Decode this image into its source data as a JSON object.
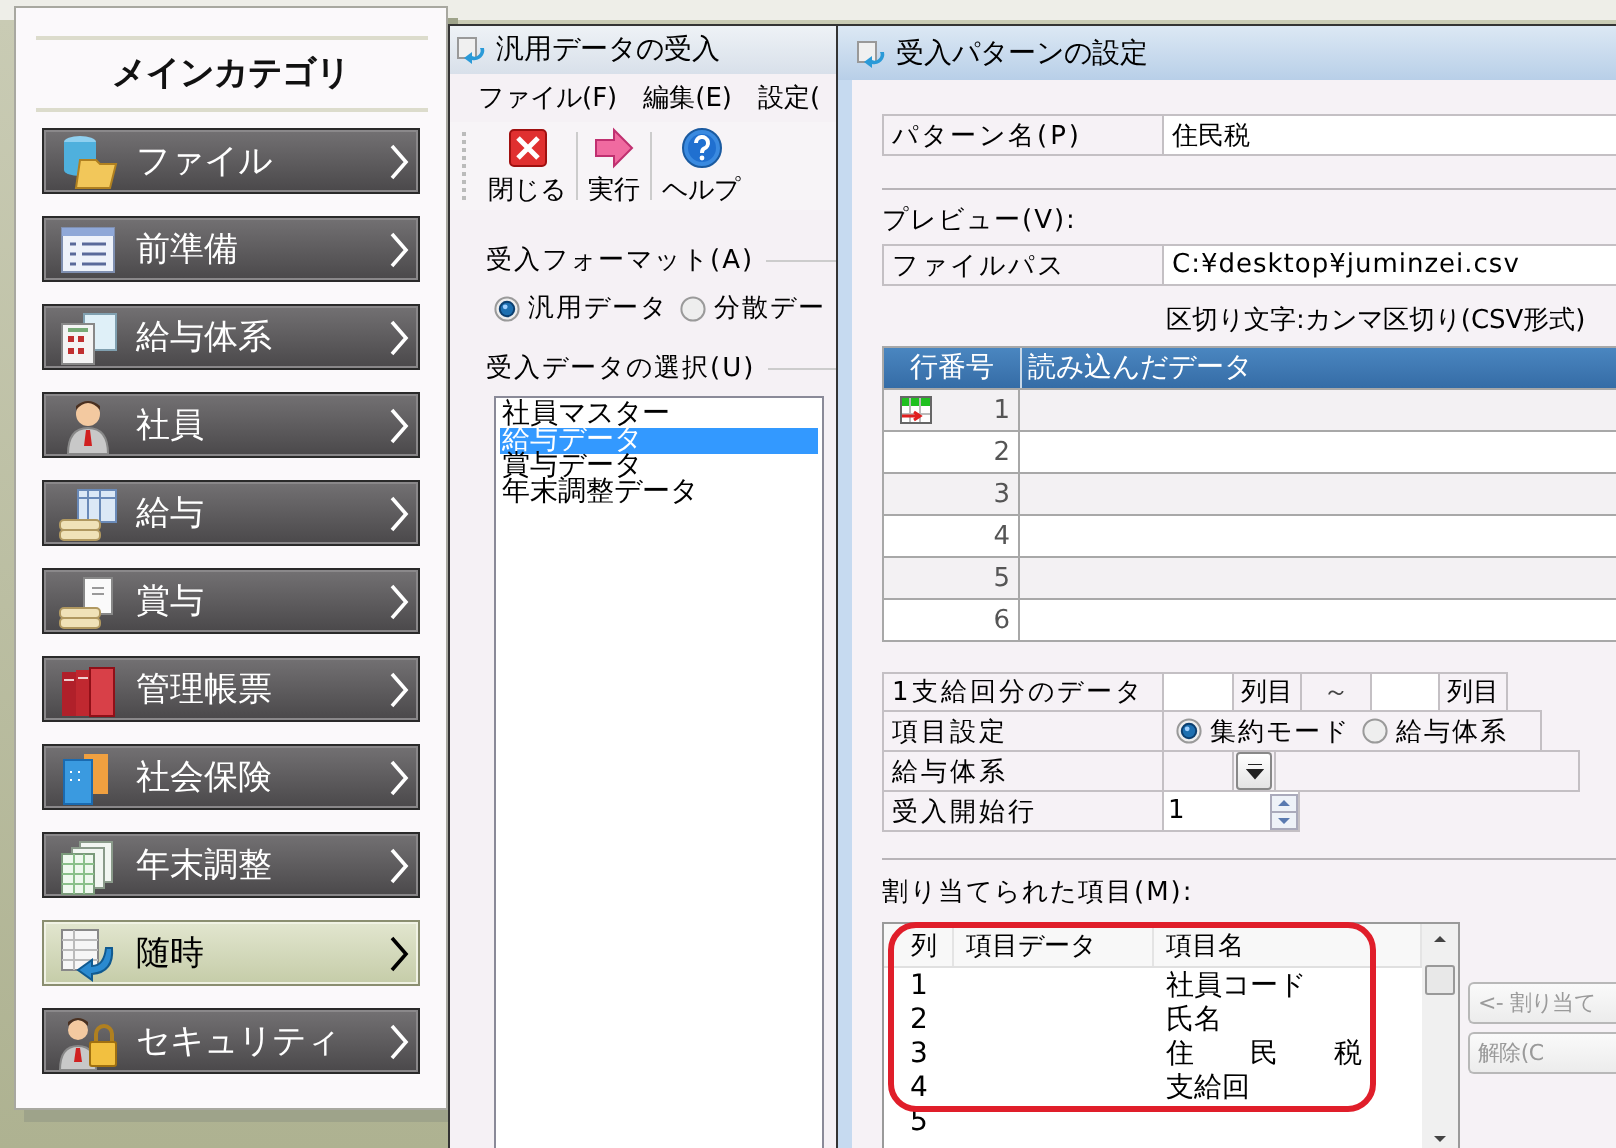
{
  "sidebar": {
    "title": "メインカテゴリ",
    "items": [
      {
        "label": "ファイル",
        "selected": false
      },
      {
        "label": "前準備",
        "selected": false
      },
      {
        "label": "給与体系",
        "selected": false
      },
      {
        "label": "社員",
        "selected": false
      },
      {
        "label": "給与",
        "selected": false
      },
      {
        "label": "賞与",
        "selected": false
      },
      {
        "label": "管理帳票",
        "selected": false
      },
      {
        "label": "社会保険",
        "selected": false
      },
      {
        "label": "年末調整",
        "selected": false
      },
      {
        "label": "随時",
        "selected": true
      },
      {
        "label": "セキュリティ",
        "selected": false
      }
    ]
  },
  "import_window": {
    "title": "汎用データの受入",
    "menu": [
      "ファイル(F)",
      "編集(E)",
      "設定("
    ],
    "toolbar": [
      {
        "kind": "close",
        "label": "閉じる"
      },
      {
        "kind": "run",
        "label": "実行"
      },
      {
        "kind": "help",
        "label": "ヘルプ"
      }
    ],
    "format": {
      "label": "受入フォーマット(A)",
      "options": [
        {
          "label": "汎用データ",
          "selected": true
        },
        {
          "label": "分散デー",
          "selected": false
        }
      ]
    },
    "data_list": {
      "label": "受入データの選択(U)",
      "items": [
        {
          "label": "社員マスター",
          "selected": false
        },
        {
          "label": "給与データ",
          "selected": true
        },
        {
          "label": "賞与データ",
          "selected": false
        },
        {
          "label": "年末調整データ",
          "selected": false
        }
      ]
    }
  },
  "pattern_window": {
    "title": "受入パターンの設定",
    "pattern_name": {
      "label": "パターン名(P)",
      "value": "住民税"
    },
    "preview": {
      "label": "プレビュー(V):",
      "file_label": "ファイルパス",
      "file_path": "C:¥desktop¥juminzei.csv",
      "delimiter": "区切り文字:カンマ区切り(CSV形式)",
      "columns": [
        "行番号",
        "読み込んだデータ"
      ],
      "rows": [
        {
          "number": "1",
          "current": true
        },
        {
          "number": "2",
          "current": false
        },
        {
          "number": "3",
          "current": false
        },
        {
          "number": "4",
          "current": false
        },
        {
          "number": "5",
          "current": false
        },
        {
          "number": "6",
          "current": false
        }
      ]
    },
    "settings": [
      {
        "kind": "range",
        "label": "1支給回分のデータ",
        "from_unit": "列目",
        "separator": "～",
        "to_unit": "列目"
      },
      {
        "kind": "radio",
        "label": "項目設定",
        "options": [
          {
            "label": "集約モード",
            "selected": true
          },
          {
            "label": "給与体系",
            "selected": false
          }
        ]
      },
      {
        "kind": "dropdown",
        "label": "給与体系"
      },
      {
        "kind": "spinner",
        "label": "受入開始行",
        "value": "1"
      }
    ],
    "assigned": {
      "label": "割り当てられた項目(M):",
      "columns": [
        "列",
        "項目データ",
        "項目名"
      ],
      "rows": [
        {
          "column": "1",
          "item_name": "社員コード"
        },
        {
          "column": "2",
          "item_name": "氏名"
        },
        {
          "column": "3",
          "item_name": "住　　民　　税"
        },
        {
          "column": "4",
          "item_name": "支給回"
        },
        {
          "column": "5"
        }
      ]
    },
    "buttons": [
      {
        "label": "<- 割り当て",
        "disabled": true
      },
      {
        "label": "解除(C",
        "disabled": true
      }
    ]
  }
}
